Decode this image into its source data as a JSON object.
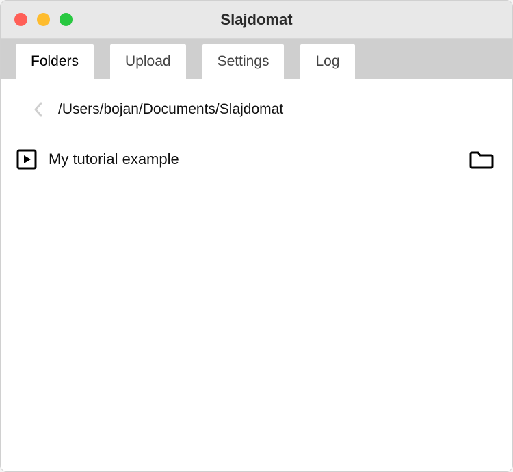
{
  "window": {
    "title": "Slajdomat"
  },
  "tabs": [
    {
      "label": "Folders",
      "active": true
    },
    {
      "label": "Upload",
      "active": false
    },
    {
      "label": "Settings",
      "active": false
    },
    {
      "label": "Log",
      "active": false
    }
  ],
  "breadcrumb": {
    "path": "/Users/bojan/Documents/Slajdomat"
  },
  "items": [
    {
      "label": "My tutorial example"
    }
  ]
}
